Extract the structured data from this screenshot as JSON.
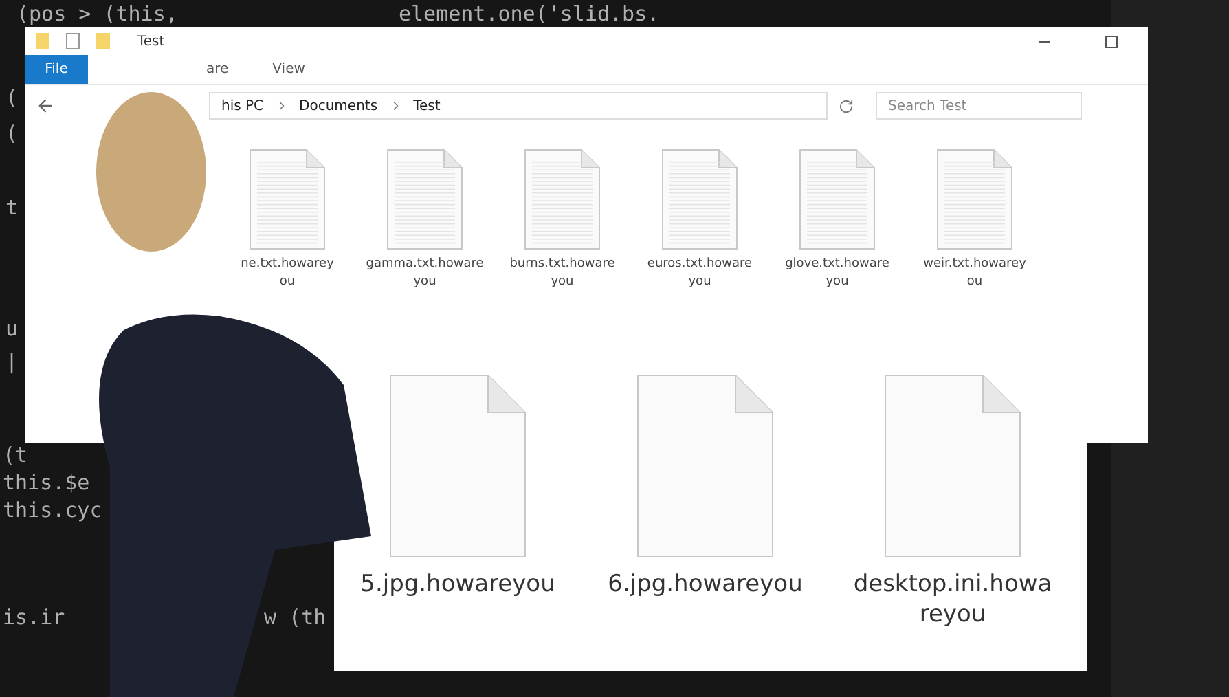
{
  "background_code": [
    "(pos > (this,",
    "element.one('slid.bs.",
    "(",
    "(",
    "t",
    "u",
    "|",
    "(t",
    "this.$e",
    "this.cyc",
    "is.ir",
    "w (th"
  ],
  "explorer": {
    "title": "Test",
    "ribbon_tabs": [
      {
        "label": "File",
        "selected": true
      },
      {
        "label": "are",
        "selected": false
      },
      {
        "label": "View",
        "selected": false
      }
    ],
    "breadcrumb": [
      "his PC",
      "Documents",
      "Test"
    ],
    "search": {
      "placeholder": "Search Test"
    },
    "files": [
      {
        "lines": [
          "ne.txt.howarey",
          "ou"
        ]
      },
      {
        "lines": [
          "gamma.txt.howare",
          "you"
        ]
      },
      {
        "lines": [
          "burns.txt.howare",
          "you"
        ]
      },
      {
        "lines": [
          "euros.txt.howare",
          "you"
        ]
      },
      {
        "lines": [
          "glove.txt.howare",
          "you"
        ]
      },
      {
        "lines": [
          "weir.txt.howarey",
          "ou"
        ]
      }
    ]
  },
  "zoomed_files": [
    {
      "lines": [
        "5.jpg.howareyou"
      ]
    },
    {
      "lines": [
        "6.jpg.howareyou"
      ]
    },
    {
      "lines": [
        "desktop.ini.howa",
        "reyou"
      ]
    }
  ]
}
